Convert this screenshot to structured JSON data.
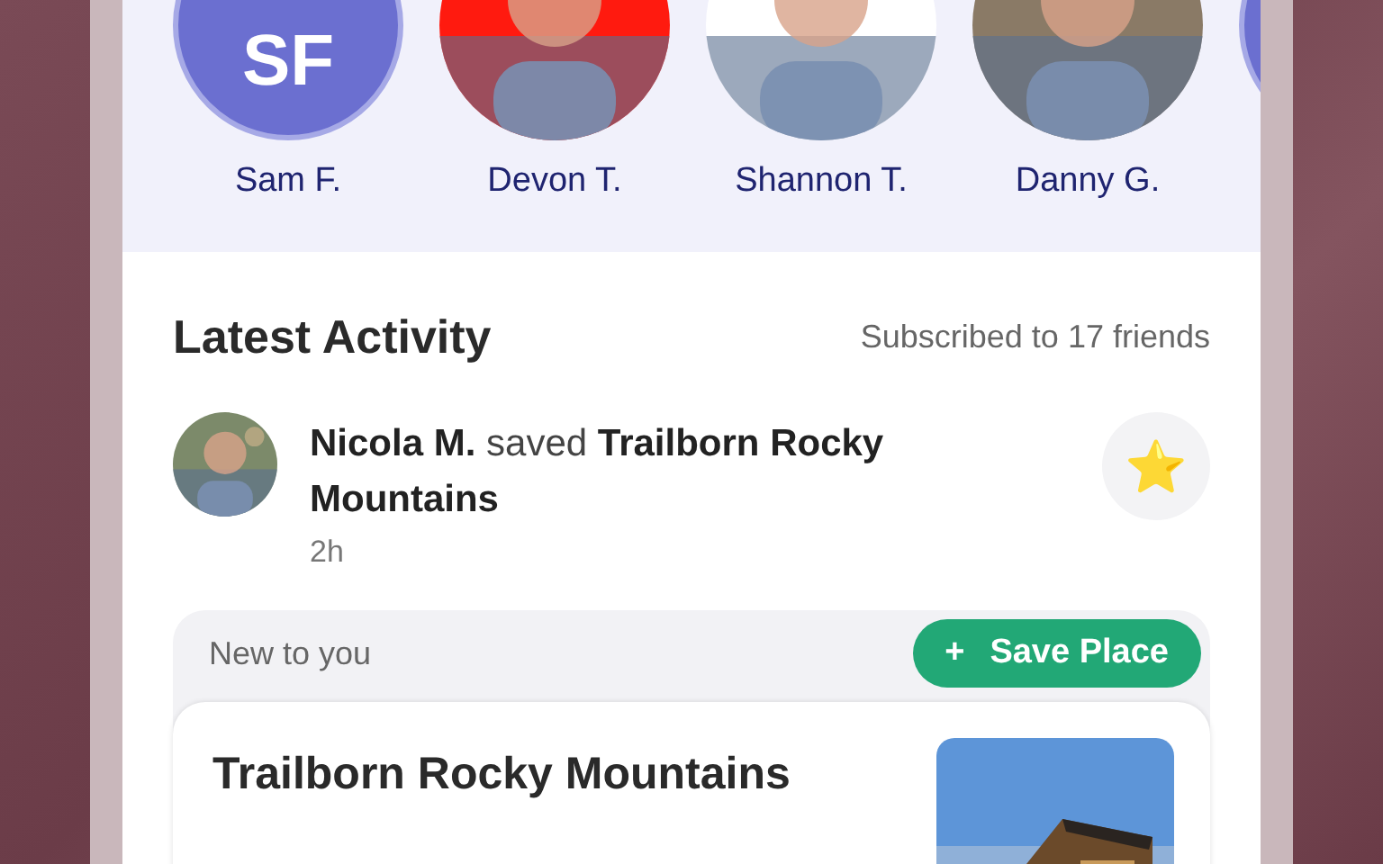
{
  "friends": [
    {
      "kind": "initials",
      "initials": "SF",
      "name": "Sam F."
    },
    {
      "kind": "picture",
      "name": "Devon T."
    },
    {
      "kind": "picture",
      "name": "Shannon T."
    },
    {
      "kind": "picture",
      "name": "Danny G."
    },
    {
      "kind": "blank"
    }
  ],
  "activity": {
    "title": "Latest Activity",
    "subscribed": "Subscribed to 17 friends",
    "item": {
      "text": "**Nicola M.** saved **Trailborn Rocky Mountains**",
      "time": "2h",
      "star": "⭐"
    }
  },
  "new_card": {
    "label": "New to you",
    "button": {
      "icon": "+",
      "label": "Save Place"
    },
    "place": {
      "title": "Trailborn Rocky Mountains"
    }
  }
}
